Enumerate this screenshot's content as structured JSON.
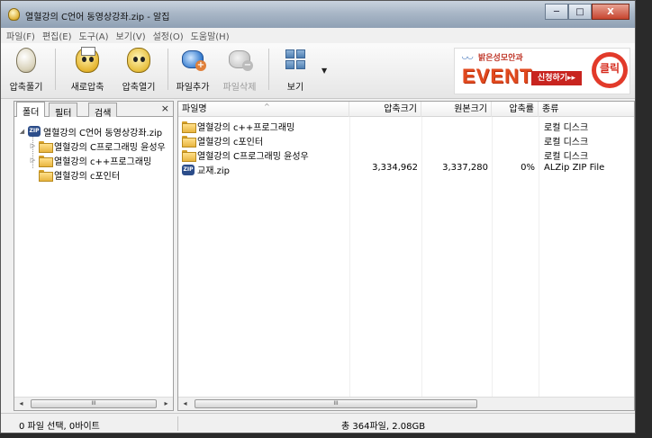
{
  "window": {
    "title": "열혈강의 C언어 동영상강좌.zip - 알집",
    "minimize": "─",
    "maximize": "□",
    "close": "X"
  },
  "menu": [
    "파일(F)",
    "편집(E)",
    "도구(A)",
    "보기(V)",
    "설정(O)",
    "도움말(H)"
  ],
  "toolbar": {
    "extract": "압축풀기",
    "new_archive": "새로압축",
    "open_archive": "압축열기",
    "add_file": "파일추가",
    "delete_file": "파일삭제",
    "view": "보기",
    "delete_disabled": true
  },
  "banner": {
    "brand": "밝은성모안과",
    "event": "EVENT",
    "cta": "신청하기▸▸",
    "badge": "클릭"
  },
  "left_panel": {
    "tabs": [
      "폴더",
      "필터",
      "검색"
    ],
    "active_tab": "폴더",
    "close": "×",
    "tree": [
      {
        "label": "열혈강의 C언어 동영상강좌.zip",
        "type": "zip",
        "expander": "◢"
      },
      {
        "label": "열혈강의 C프로그래밍 윤성우",
        "type": "folder",
        "expander": "▷"
      },
      {
        "label": "열혈강의 c++프로그래밍",
        "type": "folder",
        "expander": "▷"
      },
      {
        "label": "열혈강의 c포인터",
        "type": "folder",
        "expander": ""
      }
    ]
  },
  "list": {
    "columns": {
      "name": "파일명",
      "packed": "압축크기",
      "original": "원본크기",
      "ratio": "압축률",
      "type": "종류"
    },
    "rows": [
      {
        "name": "열혈강의 c++프로그래밍",
        "packed": "",
        "original": "",
        "ratio": "",
        "type": "로컬 디스크",
        "icon": "folder"
      },
      {
        "name": "열혈강의 c포인터",
        "packed": "",
        "original": "",
        "ratio": "",
        "type": "로컬 디스크",
        "icon": "folder"
      },
      {
        "name": "열혈강의 C프로그래밍 윤성우",
        "packed": "",
        "original": "",
        "ratio": "",
        "type": "로컬 디스크",
        "icon": "folder"
      },
      {
        "name": "교재.zip",
        "packed": "3,334,962",
        "original": "3,337,280",
        "ratio": "0%",
        "type": "ALZip ZIP File",
        "icon": "zip"
      }
    ]
  },
  "scroll": {
    "left_arrow": "◂",
    "right_arrow": "▸",
    "thumb_grip": "III"
  },
  "status": {
    "selection": "0 파일 선택,  0바이트",
    "total": "총 364파일,  2.08GB"
  }
}
